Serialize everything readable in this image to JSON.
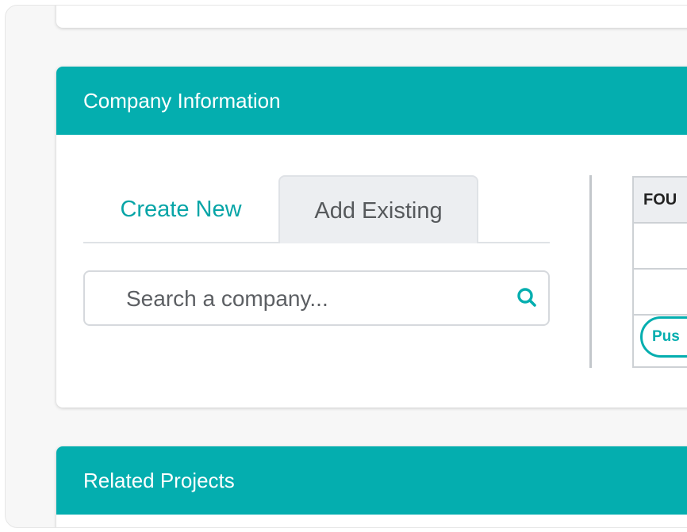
{
  "company_section": {
    "title": "Company Information",
    "tabs": [
      {
        "label": "Create New",
        "active": false
      },
      {
        "label": "Add Existing",
        "active": true
      }
    ],
    "search": {
      "placeholder": "Search a company...",
      "icon": "search-icon"
    },
    "table": {
      "header": "FOU",
      "action_label": "Pus"
    }
  },
  "related_section": {
    "title": "Related Projects"
  },
  "colors": {
    "accent": "#04aeaf",
    "tab_active_bg": "#eceef1"
  }
}
